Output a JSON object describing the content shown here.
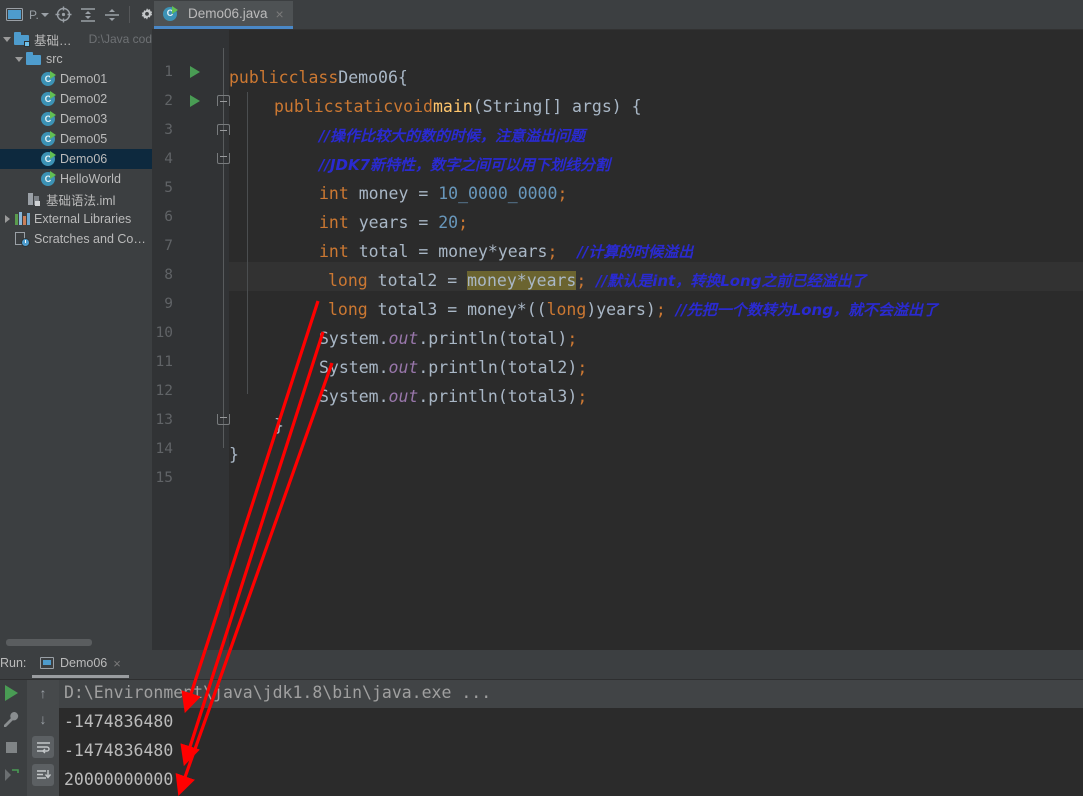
{
  "toolbar": {
    "project_icon": "project-window-icon",
    "project_label": "P.",
    "locate_icon": "locate-file-icon",
    "expand_icon": "expand-all-icon",
    "collapse_icon": "collapse-all-icon",
    "settings_icon": "gear-icon"
  },
  "tabs": [
    {
      "label": "Demo06.java",
      "icon": "java-class-icon",
      "close": "×",
      "active": true
    }
  ],
  "sidebar": {
    "items": [
      {
        "label": "基础语法",
        "path": "D:\\Java cod",
        "icon": "module-folder-icon",
        "indent": 0,
        "twisty": "down",
        "selected": false
      },
      {
        "label": "src",
        "path": "",
        "icon": "source-folder-icon",
        "indent": 1,
        "twisty": "down",
        "selected": false
      },
      {
        "label": "Demo01",
        "path": "",
        "icon": "java-class-icon",
        "indent": 2,
        "twisty": "none",
        "selected": false
      },
      {
        "label": "Demo02",
        "path": "",
        "icon": "java-class-icon",
        "indent": 2,
        "twisty": "none",
        "selected": false
      },
      {
        "label": "Demo03",
        "path": "",
        "icon": "java-class-icon",
        "indent": 2,
        "twisty": "none",
        "selected": false
      },
      {
        "label": "Demo05",
        "path": "",
        "icon": "java-class-icon",
        "indent": 2,
        "twisty": "none",
        "selected": false
      },
      {
        "label": "Demo06",
        "path": "",
        "icon": "java-class-icon",
        "indent": 2,
        "twisty": "none",
        "selected": true
      },
      {
        "label": "HelloWorld",
        "path": "",
        "icon": "java-class-icon",
        "indent": 2,
        "twisty": "none",
        "selected": false
      },
      {
        "label": "基础语法.iml",
        "path": "",
        "icon": "iml-file-icon",
        "indent": 1,
        "twisty": "none",
        "selected": false
      },
      {
        "label": "External Libraries",
        "path": "",
        "icon": "libraries-icon",
        "indent": 0,
        "twisty": "right",
        "selected": false
      },
      {
        "label": "Scratches and Consoles",
        "path": "",
        "icon": "scratches-icon",
        "indent": 0,
        "twisty": "none",
        "selected": false
      }
    ]
  },
  "editor": {
    "lines": [
      {
        "n": "1",
        "run": true,
        "fold": "",
        "highlight": false
      },
      {
        "n": "2",
        "run": true,
        "fold": "top",
        "highlight": false
      },
      {
        "n": "3",
        "run": false,
        "fold": "mid",
        "highlight": false
      },
      {
        "n": "4",
        "run": false,
        "fold": "end",
        "highlight": false
      },
      {
        "n": "5",
        "run": false,
        "fold": "",
        "highlight": false
      },
      {
        "n": "6",
        "run": false,
        "fold": "",
        "highlight": false
      },
      {
        "n": "7",
        "run": false,
        "fold": "",
        "highlight": false
      },
      {
        "n": "8",
        "run": false,
        "fold": "",
        "highlight": true
      },
      {
        "n": "9",
        "run": false,
        "fold": "",
        "highlight": false
      },
      {
        "n": "10",
        "run": false,
        "fold": "",
        "highlight": false
      },
      {
        "n": "11",
        "run": false,
        "fold": "",
        "highlight": false
      },
      {
        "n": "12",
        "run": false,
        "fold": "",
        "highlight": false
      },
      {
        "n": "13",
        "run": false,
        "fold": "end",
        "highlight": false
      },
      {
        "n": "14",
        "run": false,
        "fold": "",
        "highlight": false
      },
      {
        "n": "15",
        "run": false,
        "fold": "",
        "highlight": false
      }
    ],
    "code": {
      "l1_kw_public": "public",
      "l1_kw_class": "class",
      "l1_name": "Demo06",
      "l1_brace": "{",
      "l2": "public static void main(String[] args) {",
      "l2_kw1": "public",
      "l2_kw2": "static",
      "l2_kw3": "void",
      "l2_fn": "main",
      "l2_rest": "(String[] args) {",
      "l3_comment": "//操作比较大的数的时候，注意溢出问题",
      "l4_comment": "//JDK7新特性，数字之间可以用下划线分割",
      "l5_kw": "int",
      "l5_name": " money = ",
      "l5_num": "10_0000_0000",
      "l5_semi": ";",
      "l6_kw": "int",
      "l6_name": " years = ",
      "l6_num": "20",
      "l6_semi": ";",
      "l7_kw": "int",
      "l7_name": " total = money*years",
      "l7_semi": ";",
      "l7_comment": "//计算的时候溢出",
      "l8_kw": "long",
      "l8_name": " total2 = ",
      "l8_sel": "money*years",
      "l8_semi": ";",
      "l8_comment": "//默认是int，转换Long之前已经溢出了",
      "l9_kw1": "long",
      "l9_a": " total3 = money*((",
      "l9_kw2": "long",
      "l9_b": ")years)",
      "l9_semi": ";",
      "l9_comment": "//先把一个数转为Long，就不会溢出了",
      "l10_a": "System.",
      "l10_out": "out",
      "l10_b": ".println(total)",
      "l10_semi": ";",
      "l11_a": "System.",
      "l11_out": "out",
      "l11_b": ".println(total2)",
      "l11_semi": ";",
      "l12_a": "System.",
      "l12_out": "out",
      "l12_b": ".println(total3)",
      "l12_semi": ";",
      "l13_brace": "}",
      "l14_brace": "}"
    }
  },
  "run_panel": {
    "label": "Run:",
    "tab_label": "Demo06",
    "tab_close": "×",
    "side_icons": [
      "run-icon",
      "wrench-icon",
      "stop-icon",
      "rerun-icon",
      "scroll-up-icon",
      "scroll-down-icon",
      "soft-wrap-icon",
      "scroll-to-end-icon"
    ],
    "console": {
      "command": "D:\\Environment\\java\\jdk1.8\\bin\\java.exe ...",
      "output": [
        "-1474836480",
        "-1474836480",
        "20000000000"
      ]
    }
  },
  "colors": {
    "accent_blue": "#4a88c7",
    "keyword_orange": "#cc7832",
    "number_blue": "#6897bb",
    "comment_blue": "#2a2ad0",
    "annotation_red": "#ff0000",
    "selection_olive": "#6b6430",
    "editor_bg": "#2b2b2b",
    "chrome_bg": "#3c3f41",
    "tree_selected": "#0d293e"
  },
  "annotations": {
    "arrow_count": 3,
    "description": "three red arrows linking println statements to console output lines"
  }
}
